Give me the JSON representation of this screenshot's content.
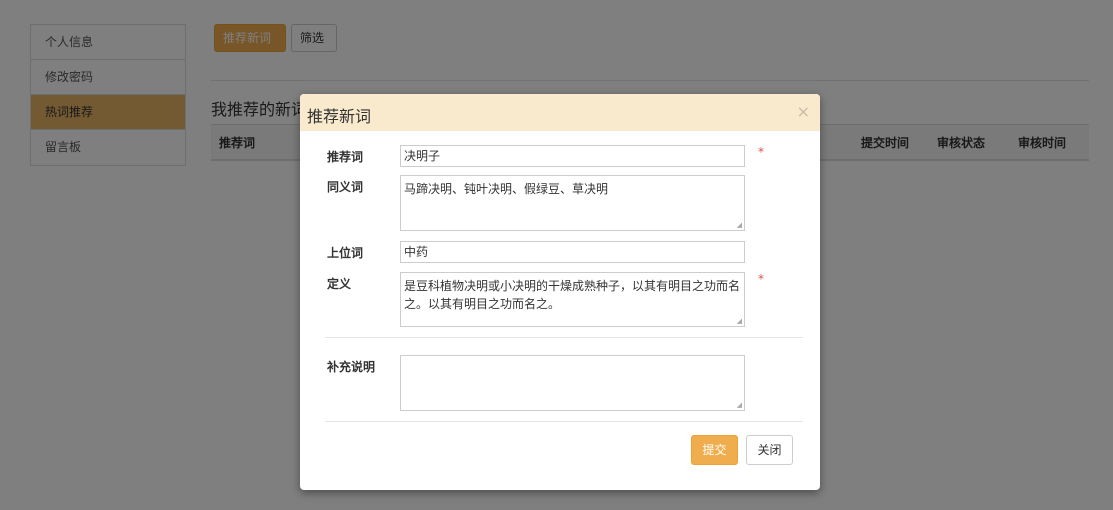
{
  "sidebar": {
    "items": [
      {
        "label": "个人信息",
        "active": false
      },
      {
        "label": "修改密码",
        "active": false
      },
      {
        "label": "热词推荐",
        "active": true
      },
      {
        "label": "留言板",
        "active": false
      }
    ]
  },
  "toolbar": {
    "recommend_label": "推荐新词",
    "filter_label": "筛选"
  },
  "section": {
    "title": "我推荐的新词"
  },
  "table": {
    "headers": [
      "推荐词",
      "提交时间",
      "审核状态",
      "审核时间"
    ]
  },
  "modal": {
    "title": "推荐新词",
    "close_glyph": "×",
    "fields": {
      "term": {
        "label": "推荐词",
        "value": "决明子",
        "required_mark": "*"
      },
      "synonyms": {
        "label": "同义词",
        "value": "马蹄决明、钝叶决明、假绿豆、草决明"
      },
      "hypernym": {
        "label": "上位词",
        "value": "中药"
      },
      "definition": {
        "label": "定义",
        "value": "是豆科植物决明或小决明的干燥成熟种子，以其有明目之功而名之。以其有明目之功而名之。",
        "required_mark": "*"
      },
      "notes": {
        "label": "补充说明",
        "value": ""
      }
    },
    "submit_label": "提交",
    "close_label": "关闭"
  },
  "colors": {
    "accent": "#f0ad4e",
    "sidebar_active": "#e6b565",
    "modal_header": "#f9eacd",
    "required": "#d9534f"
  },
  "icons": {
    "close": "close-icon",
    "resize": "resize-grip-icon"
  }
}
